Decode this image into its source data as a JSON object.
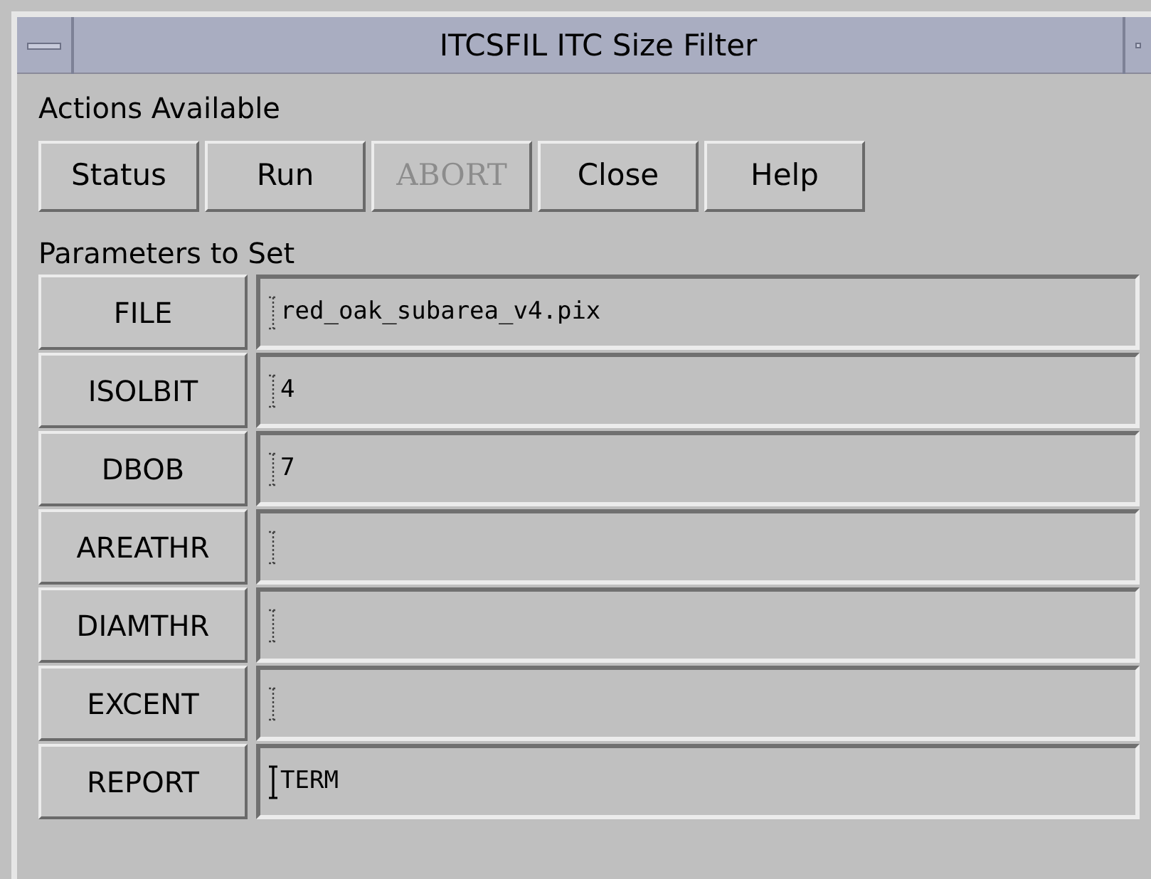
{
  "window": {
    "title": "ITCSFIL ITC Size Filter"
  },
  "actions": {
    "label": "Actions Available",
    "buttons": [
      {
        "label": "Status",
        "disabled": false
      },
      {
        "label": "Run",
        "disabled": false
      },
      {
        "label": "ABORT",
        "disabled": true
      },
      {
        "label": "Close",
        "disabled": false
      },
      {
        "label": "Help",
        "disabled": false
      }
    ]
  },
  "parameters": {
    "label": "Parameters to Set",
    "rows": [
      {
        "name": "FILE",
        "value": "red_oak_subarea_v4.pix",
        "focused": false
      },
      {
        "name": "ISOLBIT",
        "value": "4",
        "focused": false
      },
      {
        "name": "DBOB",
        "value": "7",
        "focused": false
      },
      {
        "name": "AREATHR",
        "focused": false
      },
      {
        "name": "DIAMTHR",
        "focused": false
      },
      {
        "name": "EXCENT",
        "focused": false
      },
      {
        "name": "REPORT",
        "value": "TERM",
        "focused": true
      }
    ]
  }
}
